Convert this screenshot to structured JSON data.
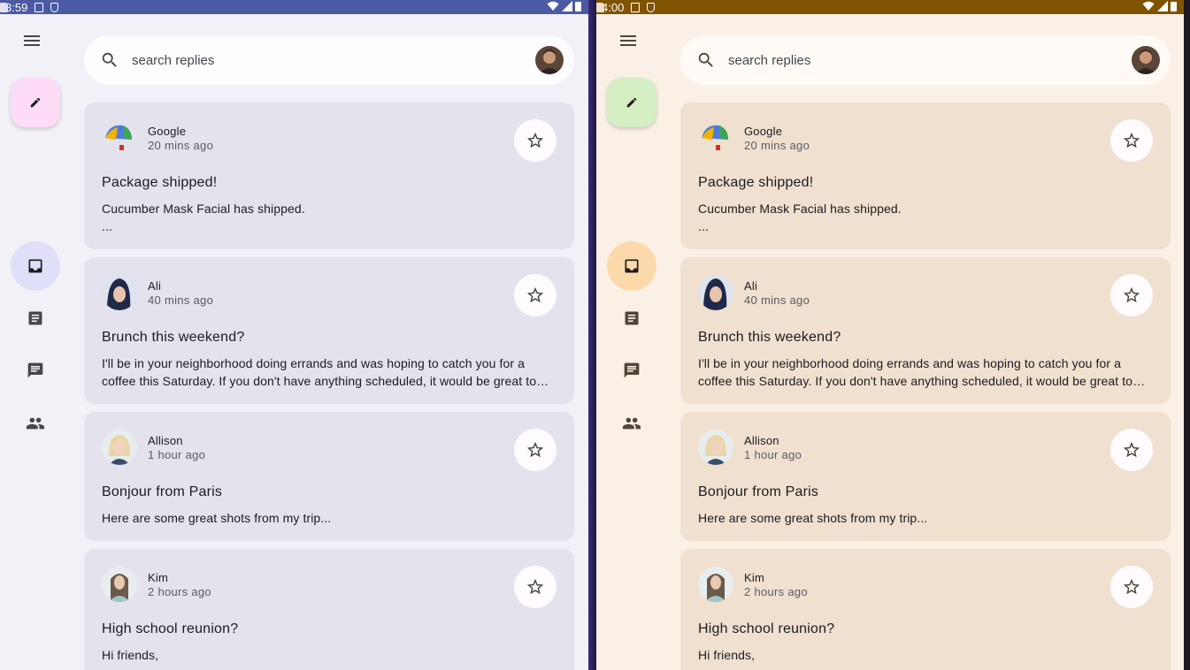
{
  "panes": {
    "left": {
      "status_time": "3:59",
      "accent": "#4b5aa3"
    },
    "right": {
      "status_time": "4:00",
      "accent": "#7f5300"
    }
  },
  "search": {
    "placeholder": "search replies"
  },
  "nav": {
    "menu_icon": "menu-icon",
    "compose_icon": "edit-icon",
    "items": [
      {
        "icon": "inbox-icon",
        "active": true
      },
      {
        "icon": "article-icon",
        "active": false
      },
      {
        "icon": "chat-icon",
        "active": false
      },
      {
        "icon": "people-icon",
        "active": false
      }
    ]
  },
  "emails": [
    {
      "sender": "Google",
      "time": "20 mins ago",
      "subject": "Package shipped!",
      "body": "Cucumber Mask Facial has shipped.",
      "body_more": "..."
    },
    {
      "sender": "Ali",
      "time": "40 mins ago",
      "subject": "Brunch this weekend?",
      "body": "I'll be in your neighborhood doing errands and was hoping to catch you for a coffee this Saturday. If you don't have anything scheduled, it would be great to see you!"
    },
    {
      "sender": "Allison",
      "time": "1 hour ago",
      "subject": "Bonjour from Paris",
      "body": "Here are some great shots from my trip..."
    },
    {
      "sender": "Kim",
      "time": "2 hours ago",
      "subject": "High school reunion?",
      "body": "Hi friends,"
    }
  ]
}
